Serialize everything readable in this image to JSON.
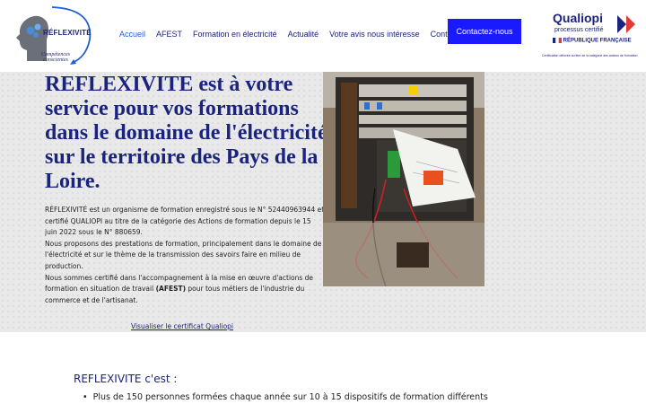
{
  "header": {
    "logo_title": "RÉFLEXIVITÉ",
    "logo_tagline_line1": "Compétences",
    "logo_tagline_line2": "conscientes",
    "nav": [
      {
        "label": "Accueil",
        "active": true
      },
      {
        "label": "AFEST",
        "active": false
      },
      {
        "label": "Formation en électricité",
        "active": false
      },
      {
        "label": "Actualité",
        "active": false
      },
      {
        "label": "Votre avis nous intéresse",
        "active": false
      },
      {
        "label": "Contact",
        "active": false
      }
    ],
    "contact_button": "Contactez-nous",
    "qualiopi": {
      "brand": "Qualiopi",
      "sub": "processus certifié",
      "republique": "RÉPUBLIQUE FRANÇAISE",
      "cert_note": "Certification délivrée au titre de la catégorie des actions de formation"
    }
  },
  "hero": {
    "title": "REFLEXIVITE est à votre service pour vos formations dans le domaine de l'électricité sur le territoire des Pays de la Loire.",
    "body": [
      "RÉFLEXIVITÉ est un organisme de formation enregistré sous le N° 52440963944 et certifié QUALIOPI au titre de la catégorie des Actions de formation depuis le 15 juin 2022 sous le N° 880659.",
      "Nous proposons des prestations de formation, principalement dans le domaine de l'électricité et sur le thème de la transmission des savoirs faire en milieu de production.",
      "Nous sommes certifié dans l'accompagnement à la mise en œuvre d'actions de formation en situation de travail",
      "(AFEST)",
      "pour tous métiers de l'industrie du commerce et de l'artisanat."
    ],
    "cert_link": "Visualiser le certificat Qualiopi"
  },
  "section": {
    "title": "REFLEXIVITE c'est :",
    "items": [
      "Plus de 150 personnes formées chaque année sur 10 à 15 dispositifs de formation différents"
    ]
  },
  "colors": {
    "brand_blue": "#1a237e",
    "button_blue": "#1a1aff",
    "hero_bg": "#e9e9ea"
  }
}
